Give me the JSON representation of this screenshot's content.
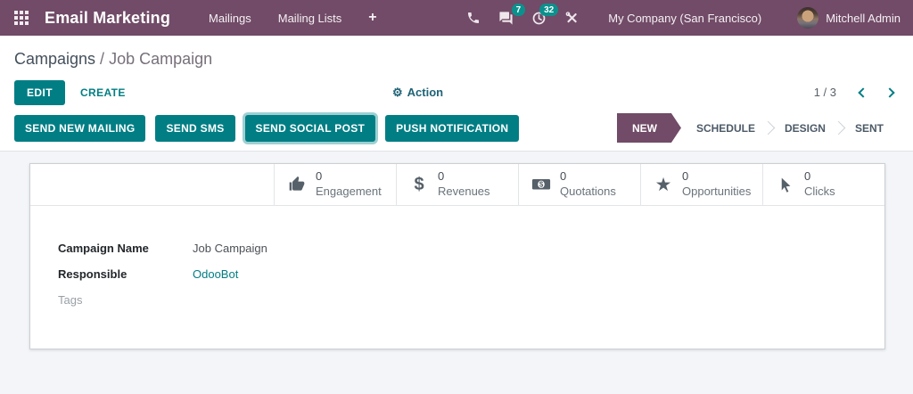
{
  "navbar": {
    "brand": "Email Marketing",
    "menus": [
      {
        "label": "Mailings"
      },
      {
        "label": "Mailing Lists"
      },
      {
        "label": "+"
      }
    ],
    "systray": {
      "phone_icon": "phone-icon",
      "messages_icon": "chat-bubbles-icon",
      "messages_badge": "7",
      "activities_icon": "clock-icon",
      "activities_badge": "32",
      "tools_icon": "crossed-tools-icon",
      "company": "My Company (San Francisco)",
      "user": "Mitchell Admin"
    }
  },
  "breadcrumb": {
    "parent": "Campaigns",
    "separator": " / ",
    "current": "Job Campaign"
  },
  "control_panel": {
    "edit_label": "EDIT",
    "create_label": "CREATE",
    "action_icon": "⚙",
    "action_label": "Action",
    "pager": {
      "text": "1 / 3"
    }
  },
  "action_buttons": [
    {
      "label": "SEND NEW MAILING",
      "focused": false
    },
    {
      "label": "SEND SMS",
      "focused": false
    },
    {
      "label": "SEND SOCIAL POST",
      "focused": true
    },
    {
      "label": "PUSH NOTIFICATION",
      "focused": false
    }
  ],
  "statusbar": {
    "steps": [
      {
        "label": "NEW",
        "active": true
      },
      {
        "label": "SCHEDULE",
        "active": false
      },
      {
        "label": "DESIGN",
        "active": false
      },
      {
        "label": "SENT",
        "active": false
      }
    ]
  },
  "stat_buttons": [
    {
      "icon": "thumbs-up-icon",
      "value": "0",
      "label": "Engagement"
    },
    {
      "icon": "dollar-icon",
      "glyph": "$",
      "value": "0",
      "label": "Revenues"
    },
    {
      "icon": "money-bill-icon",
      "value": "0",
      "label": "Quotations"
    },
    {
      "icon": "star-icon",
      "glyph": "★",
      "value": "0",
      "label": "Opportunities"
    },
    {
      "icon": "mouse-cursor-icon",
      "value": "0",
      "label": "Clicks"
    }
  ],
  "form": {
    "fields": [
      {
        "label": "Campaign Name",
        "value": "Job Campaign",
        "type": "text"
      },
      {
        "label": "Responsible",
        "value": "OdooBot",
        "type": "link"
      },
      {
        "label": "Tags",
        "value": "",
        "type": "empty"
      }
    ]
  },
  "colors": {
    "navbar_bg": "#714B67",
    "accent_teal": "#017E84",
    "badge_teal": "#0b918d",
    "active_step_bg": "#714B67",
    "page_bg": "#f3f5f8"
  }
}
